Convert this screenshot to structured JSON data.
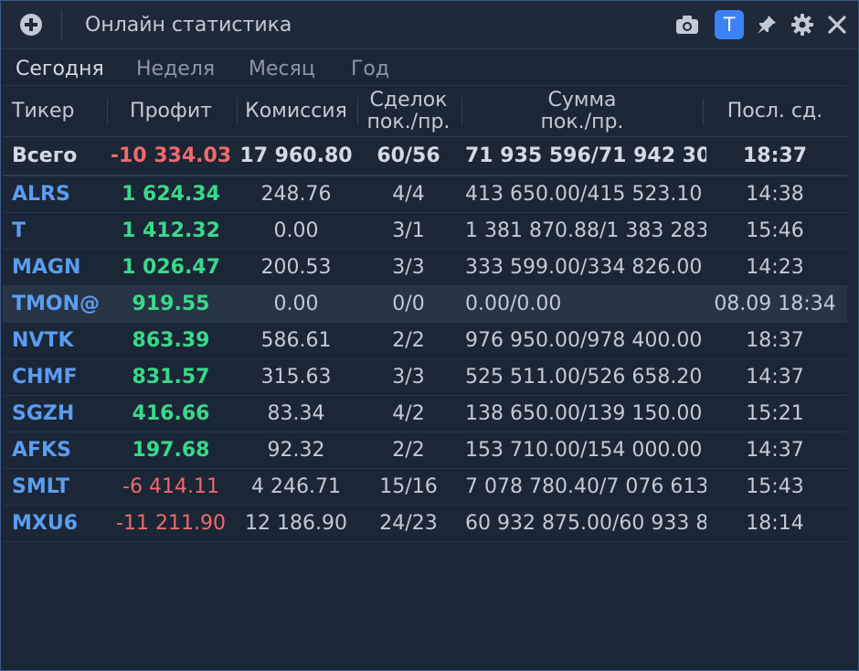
{
  "window": {
    "title": "Онлайн статистика",
    "t_button": "T"
  },
  "icons": [
    "add-icon",
    "camera-icon",
    "pin-icon",
    "gear-icon",
    "close-icon"
  ],
  "tabs": [
    {
      "label": "Сегодня",
      "active": true
    },
    {
      "label": "Неделя",
      "active": false
    },
    {
      "label": "Месяц",
      "active": false
    },
    {
      "label": "Год",
      "active": false
    }
  ],
  "columns": {
    "ticker": "Тикер",
    "profit": "Профит",
    "commission": "Комиссия",
    "deals_1": "Сделок",
    "deals_2": "пок./пр.",
    "sum_1": "Сумма",
    "sum_2": "пок./пр.",
    "last": "Посл. сд."
  },
  "total": {
    "label": "Всего",
    "profit": "-10 334.03",
    "commission": "17 960.80",
    "deals": "60/56",
    "sum": "71 935 596/71 942 30",
    "last": "18:37"
  },
  "rows": [
    {
      "ticker": "ALRS",
      "profit": "1 624.34",
      "commission": "248.76",
      "deals": "4/4",
      "sum": "413 650.00/415 523.10",
      "last": "14:38"
    },
    {
      "ticker": "T",
      "profit": "1 412.32",
      "commission": "0.00",
      "deals": "3/1",
      "sum": "1 381 870.88/1 383 283",
      "last": "15:46"
    },
    {
      "ticker": "MAGN",
      "profit": "1 026.47",
      "commission": "200.53",
      "deals": "3/3",
      "sum": "333 599.00/334 826.00",
      "last": "14:23"
    },
    {
      "ticker": "TMON@",
      "profit": "919.55",
      "commission": "0.00",
      "deals": "0/0",
      "sum": "0.00/0.00",
      "last": "08.09 18:34"
    },
    {
      "ticker": "NVTK",
      "profit": "863.39",
      "commission": "586.61",
      "deals": "2/2",
      "sum": "976 950.00/978 400.00",
      "last": "18:37"
    },
    {
      "ticker": "CHMF",
      "profit": "831.57",
      "commission": "315.63",
      "deals": "3/3",
      "sum": "525 511.00/526 658.20",
      "last": "14:37"
    },
    {
      "ticker": "SGZH",
      "profit": "416.66",
      "commission": "83.34",
      "deals": "4/2",
      "sum": "138 650.00/139 150.00",
      "last": "15:21"
    },
    {
      "ticker": "AFKS",
      "profit": "197.68",
      "commission": "92.32",
      "deals": "2/2",
      "sum": "153 710.00/154 000.00",
      "last": "14:37"
    },
    {
      "ticker": "SMLT",
      "profit": "-6 414.11",
      "commission": "4 246.71",
      "deals": "15/16",
      "sum": "7 078 780.40/7 076 613",
      "last": "15:43"
    },
    {
      "ticker": "MXU6",
      "profit": "-11 211.90",
      "commission": "12 186.90",
      "deals": "24/23",
      "sum": "60 932 875.00/60 933 8",
      "last": "18:14"
    }
  ],
  "colors": {
    "positive": "#39d98a",
    "negative": "#f06a6a",
    "ticker": "#5b9df0",
    "accent": "#3b82f6",
    "background": "#1b2636"
  }
}
